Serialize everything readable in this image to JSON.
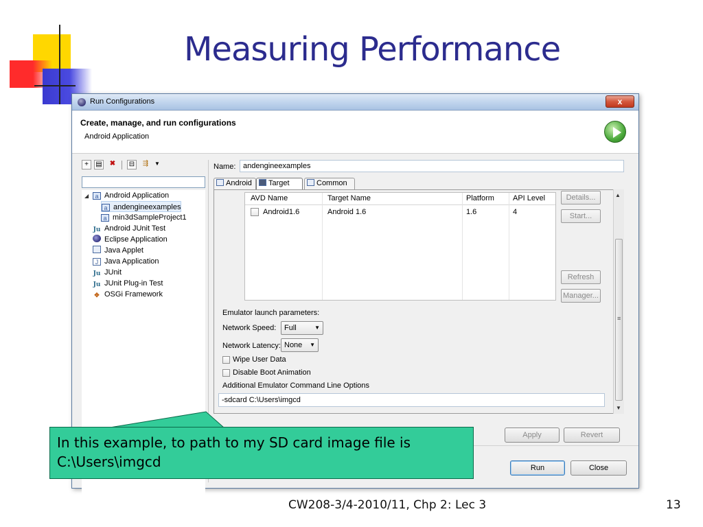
{
  "slide": {
    "title": "Measuring Performance",
    "footer": "CW208-3/4-2010/11, Chp 2: Lec 3",
    "page_number": "13"
  },
  "dialog": {
    "window_title": "Run Configurations",
    "close_label": "x",
    "header_title": "Create, manage, and run configurations",
    "header_subtitle": "Android Application"
  },
  "left_panel": {
    "filter_value": "",
    "tree": [
      {
        "label": "Android Application",
        "icon": "android-app-icon",
        "level": 0,
        "expander": "◢"
      },
      {
        "label": "andengineexamples",
        "icon": "android-app-icon",
        "level": 1,
        "selected": true
      },
      {
        "label": "min3dSampleProject1",
        "icon": "android-app-icon",
        "level": 1
      },
      {
        "label": "Android JUnit Test",
        "icon": "junit-icon",
        "level": 0
      },
      {
        "label": "Eclipse Application",
        "icon": "eclipse-icon",
        "level": 0
      },
      {
        "label": "Java Applet",
        "icon": "applet-icon",
        "level": 0
      },
      {
        "label": "Java Application",
        "icon": "java-app-icon",
        "level": 0
      },
      {
        "label": "JUnit",
        "icon": "junit-icon",
        "level": 0
      },
      {
        "label": "JUnit Plug-in Test",
        "icon": "junit-plugin-icon",
        "level": 0
      },
      {
        "label": "OSGi Framework",
        "icon": "osgi-icon",
        "level": 0
      }
    ]
  },
  "right_panel": {
    "name_label": "Name:",
    "name_value": "andengineexamples",
    "tabs": [
      {
        "label": "Android",
        "active": false
      },
      {
        "label": "Target",
        "active": true
      },
      {
        "label": "Common",
        "active": false
      }
    ],
    "avd_table": {
      "columns": [
        "AVD Name",
        "Target Name",
        "Platform",
        "API Level"
      ],
      "rows": [
        {
          "checked": false,
          "avd_name": "Android1.6",
          "target_name": "Android 1.6",
          "platform": "1.6",
          "api_level": "4"
        }
      ]
    },
    "side_buttons": {
      "details": "Details...",
      "start": "Start...",
      "refresh": "Refresh",
      "manager": "Manager..."
    },
    "emulator": {
      "section_label": "Emulator launch parameters:",
      "network_speed_label": "Network Speed:",
      "network_speed_value": "Full",
      "network_latency_label": "Network Latency:",
      "network_latency_value": "None",
      "wipe_user_data_label": "Wipe User Data",
      "wipe_user_data_checked": false,
      "disable_boot_anim_label": "Disable Boot Animation",
      "disable_boot_anim_checked": false,
      "additional_options_label": "Additional Emulator Command Line Options",
      "additional_options_value": "-sdcard C:\\Users\\imgcd"
    }
  },
  "buttons": {
    "apply": "Apply",
    "revert": "Revert",
    "run": "Run",
    "close": "Close"
  },
  "callout": {
    "line1": "In this example, to path to my SD card image file is",
    "line2": "C:\\Users\\imgcd"
  },
  "colors": {
    "title": "#2c2c8e",
    "callout": "#33cc99"
  }
}
